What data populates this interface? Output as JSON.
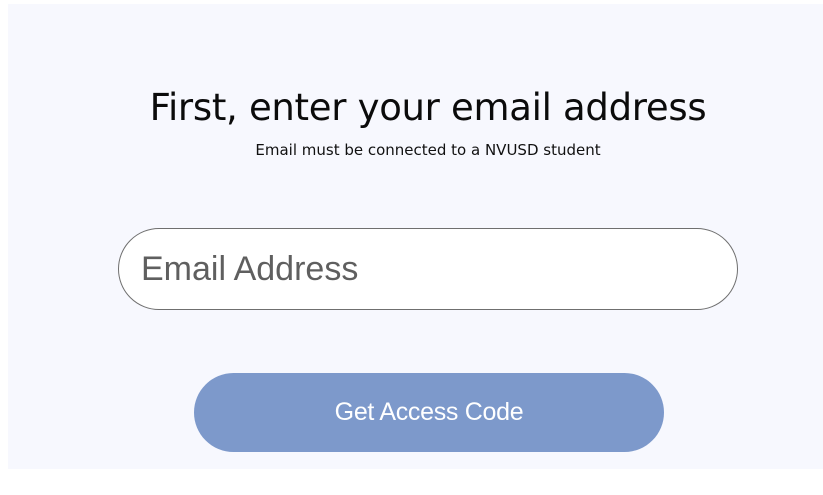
{
  "heading": {
    "title": "First, enter your email address",
    "subtitle": "Email must be connected to a NVUSD student"
  },
  "email_field": {
    "value": "",
    "placeholder": "Email Address"
  },
  "submit_button": {
    "label": "Get Access Code",
    "color": "#7d99cb",
    "text_color": "#ffffff"
  },
  "colors": {
    "page_background": "#f7f8fe",
    "border": "#6f6f6f"
  }
}
